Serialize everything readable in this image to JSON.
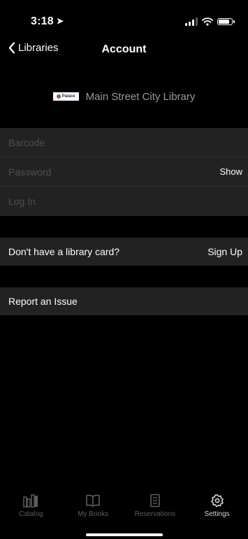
{
  "status_bar": {
    "time": "3:18"
  },
  "nav": {
    "back_label": "Libraries",
    "title": "Account"
  },
  "library": {
    "logo_text": "Palace",
    "name": "Main Street City Library"
  },
  "login_form": {
    "barcode_placeholder": "Barcode",
    "password_placeholder": "Password",
    "show_label": "Show",
    "login_label": "Log In"
  },
  "signup_row": {
    "label": "Don't have a library card?",
    "action": "Sign Up"
  },
  "report_row": {
    "label": "Report an Issue"
  },
  "tab_bar": {
    "items": [
      {
        "label": "Catalog",
        "icon": "catalog-icon",
        "active": false
      },
      {
        "label": "My Books",
        "icon": "book-icon",
        "active": false
      },
      {
        "label": "Reservations",
        "icon": "reservations-icon",
        "active": false
      },
      {
        "label": "Settings",
        "icon": "gear-icon",
        "active": true
      }
    ]
  },
  "colors": {
    "background": "#000000",
    "row": "#222222",
    "placeholder": "#4f4f4f",
    "tab_inactive": "#5e5e5e"
  }
}
